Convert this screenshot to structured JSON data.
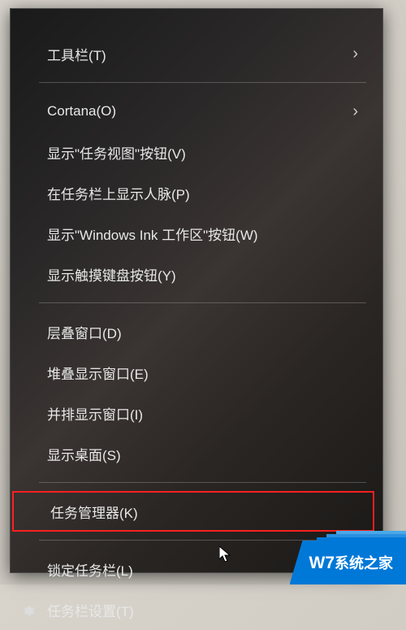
{
  "menu": {
    "groups": [
      {
        "items": [
          {
            "id": "toolbars",
            "label": "工具栏(T)",
            "submenu": true
          }
        ]
      },
      {
        "items": [
          {
            "id": "cortana",
            "label": "Cortana(O)",
            "submenu": true
          },
          {
            "id": "show-task-view",
            "label": "显示\"任务视图\"按钮(V)"
          },
          {
            "id": "show-people",
            "label": "在任务栏上显示人脉(P)"
          },
          {
            "id": "show-windows-ink",
            "label": "显示\"Windows Ink 工作区\"按钮(W)"
          },
          {
            "id": "show-touch-keyboard",
            "label": "显示触摸键盘按钮(Y)"
          }
        ]
      },
      {
        "items": [
          {
            "id": "cascade-windows",
            "label": "层叠窗口(D)"
          },
          {
            "id": "stack-windows",
            "label": "堆叠显示窗口(E)"
          },
          {
            "id": "side-by-side",
            "label": "并排显示窗口(I)"
          },
          {
            "id": "show-desktop",
            "label": "显示桌面(S)"
          }
        ]
      },
      {
        "items": [
          {
            "id": "task-manager",
            "label": "任务管理器(K)",
            "highlight": true
          }
        ]
      },
      {
        "items": [
          {
            "id": "lock-taskbar",
            "label": "锁定任务栏(L)"
          },
          {
            "id": "taskbar-settings",
            "label": "任务栏设置(T)",
            "icon": "gear"
          }
        ]
      }
    ]
  },
  "watermark": {
    "prefix": "W7",
    "text": "系统之家"
  }
}
